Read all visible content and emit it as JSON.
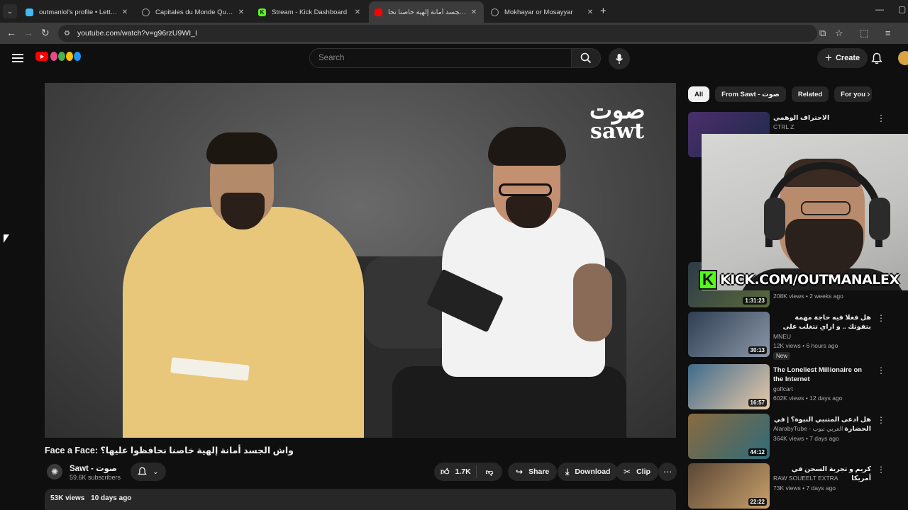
{
  "browser": {
    "tabs": [
      {
        "title": "outmanlol's profile • Letterboxd",
        "fav_color": "#40bcf4",
        "active": false
      },
      {
        "title": "Capitales du Monde Quiz - Jeu",
        "fav_color": "#9aa0a6",
        "active": false
      },
      {
        "title": "Stream - Kick Dashboard",
        "fav_color": "#53fc18",
        "active": false
      },
      {
        "title": "واش الجسد أمانة إلهية خاصنا نحا",
        "fav_color": "#ff0000",
        "active": true
      },
      {
        "title": "Mokhayar or Mosayyar",
        "fav_color": "#9aa0a6",
        "active": false
      }
    ],
    "url": "youtube.com/watch?v=g96rzU9WI_I",
    "nav": {
      "back": "←",
      "forward": "→",
      "reload": "↻"
    }
  },
  "youtube": {
    "search_placeholder": "Search",
    "create_label": "Create",
    "video": {
      "title": "Face a Face: واش الجسد أمانة إلهية خاصنا نحافظوا عليها؟",
      "brand_mark_top": "صوت",
      "brand_mark_bottom": "sawt"
    },
    "channel": {
      "name": "Sawt - صوت",
      "subscribers": "59.6K subscribers",
      "avatar_glyph": "✺"
    },
    "actions": {
      "likes": "1.7K",
      "share": "Share",
      "download": "Download",
      "clip": "Clip",
      "more": "⋯"
    },
    "description": {
      "views": "53K views",
      "date": "10 days ago"
    },
    "chips": [
      "All",
      "From Sawt - صوت",
      "Related",
      "For you"
    ],
    "recommendations": [
      {
        "title": "الاحتراف الوهمي",
        "channel": "CTRL Z",
        "meta": "",
        "duration": "",
        "thumb": "#3a2a4d",
        "verified": false,
        "new": false
      },
      {
        "title": "",
        "channel": "",
        "meta": "208K views • 2 weeks ago",
        "duration": "1:31:23",
        "thumb": "#2d3a48",
        "verified": false,
        "new": false
      },
      {
        "title": "هل فعلا فيه حاجة مهمة بتفوتك .. و ازاي تتغلب على رعبك المستمر في المنافسة ..",
        "channel": "MNEU",
        "meta": "12K views • 6 hours ago",
        "duration": "30:13",
        "thumb": "#2f3e52",
        "verified": true,
        "new": true,
        "new_label": "New"
      },
      {
        "title": "The Loneliest Millionaire on the Internet",
        "channel": "golfcart",
        "meta": "602K views • 12 days ago",
        "duration": "16:57",
        "thumb": "#3f6b8c",
        "verified": false,
        "new": false
      },
      {
        "title": "هل ادعى المتنبي النبوة؟ | في الحضارة",
        "channel": "AlarabyTube - العربي تيوب",
        "meta": "364K views • 7 days ago",
        "duration": "44:12",
        "thumb": "#8b6a3e",
        "verified": true,
        "new": false
      },
      {
        "title": "كريم و تجربة السجن في أمريكا",
        "channel": "RAW SOUEELT EXTRA",
        "meta": "73K views • 7 days ago",
        "duration": "22:22",
        "thumb": "#5a4636",
        "verified": false,
        "new": false
      }
    ]
  },
  "overlay": {
    "kick_letter": "K",
    "kick_text": "KICK.COM/OUTMANALEX"
  },
  "colors": {
    "bg": "#0f0f0f",
    "yt_red": "#ff0000",
    "kick_green": "#53fc18",
    "chip_bg": "#272727"
  }
}
